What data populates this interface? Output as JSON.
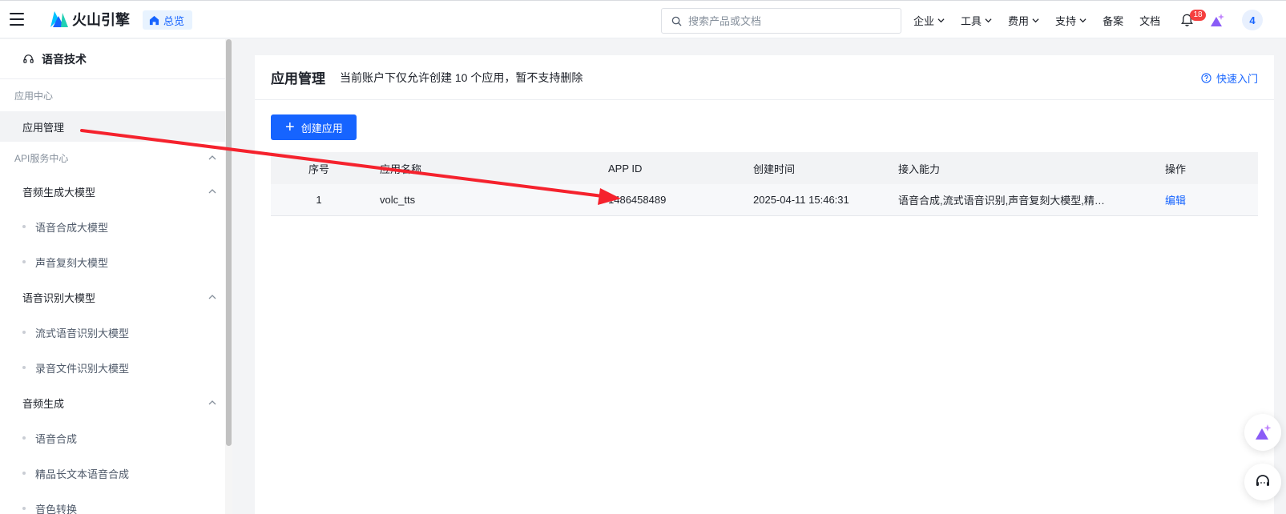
{
  "brand": {
    "name": "火山引擎",
    "home_label": "总览"
  },
  "search": {
    "placeholder": "搜索产品或文档"
  },
  "nav": [
    {
      "label": "企业",
      "has_dropdown": true
    },
    {
      "label": "工具",
      "has_dropdown": true
    },
    {
      "label": "费用",
      "has_dropdown": true
    },
    {
      "label": "支持",
      "has_dropdown": true
    },
    {
      "label": "备案",
      "has_dropdown": false
    },
    {
      "label": "文档",
      "has_dropdown": false
    }
  ],
  "notifications": {
    "count": "18"
  },
  "user": {
    "avatar_text": "4"
  },
  "sidebar": {
    "title": "语音技术",
    "group_app_center": "应用中心",
    "item_app_manage": "应用管理",
    "group_api": "API服务中心",
    "sub_audio_gen_model": "音频生成大模型",
    "leaf_tts_model": "语音合成大模型",
    "leaf_voice_clone": "声音复刻大模型",
    "sub_asr_model": "语音识别大模型",
    "leaf_stream_asr": "流式语音识别大模型",
    "leaf_file_asr": "录音文件识别大模型",
    "sub_audio_gen": "音频生成",
    "leaf_tts": "语音合成",
    "leaf_long_tts": "精品长文本语音合成",
    "leaf_voice_convert": "音色转换"
  },
  "main": {
    "title": "应用管理",
    "description": "当前账户下仅允许创建 10 个应用，暂不支持删除",
    "quick_start": "快速入门",
    "create_button": "创建应用",
    "table": {
      "headers": [
        "序号",
        "应用名称",
        "APP ID",
        "创建时间",
        "接入能力",
        "操作"
      ],
      "rows": [
        [
          "1",
          "volc_tts",
          "1486458489",
          "2025-04-11 15:46:31",
          "语音合成,流式语音识别,声音复刻大模型,精品长文本语音合成",
          "编辑"
        ]
      ]
    }
  },
  "colors": {
    "accent": "#1664ff",
    "badge": "#f53f3f",
    "annotation": "#f5222d"
  }
}
